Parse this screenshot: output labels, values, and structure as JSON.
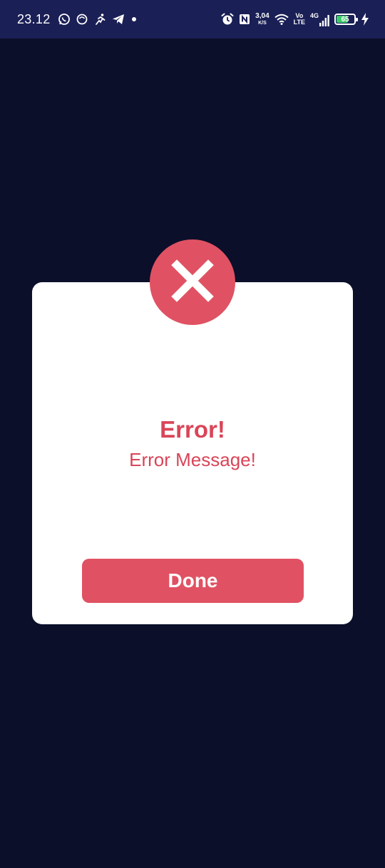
{
  "status_bar": {
    "time": "23.12",
    "left_icons": [
      "whatsapp-icon",
      "app-icon",
      "running-icon",
      "telegram-icon",
      "dot-icon"
    ],
    "right_icons": [
      "alarm-icon",
      "nfc-icon",
      "wifi-icon",
      "signal-icon",
      "charging-icon"
    ],
    "net_speed_value": "3,04",
    "net_speed_unit": "K/S",
    "volte_top": "Vo",
    "volte_bottom": "LTE",
    "network_type": "4G",
    "battery_level": "65",
    "battery_fraction": 0.65
  },
  "dialog": {
    "icon": "close-icon",
    "title": "Error!",
    "message": "Error Message!",
    "done_label": "Done"
  },
  "colors": {
    "background": "#0c0f2a",
    "status_bar": "#1a1f56",
    "accent": "#e05263",
    "text_accent": "#d94558",
    "card": "#ffffff",
    "battery_fill": "#3ec96a"
  }
}
